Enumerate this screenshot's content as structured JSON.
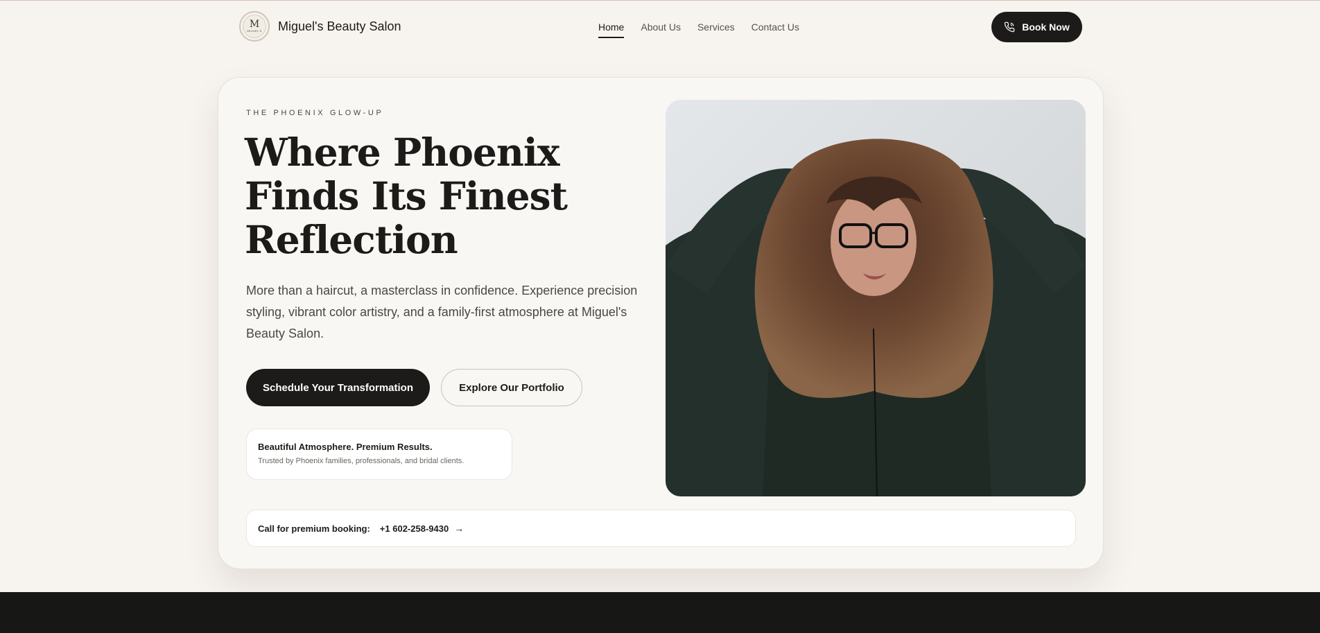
{
  "brand": {
    "name": "Miguel's Beauty Salon",
    "logo_mark": "M",
    "logo_text": "MIGUEL'S"
  },
  "nav": {
    "items": [
      {
        "label": "Home",
        "active": true
      },
      {
        "label": "About Us",
        "active": false
      },
      {
        "label": "Services",
        "active": false
      },
      {
        "label": "Contact Us",
        "active": false
      }
    ],
    "book_label": "Book Now",
    "book_icon": "phone-icon"
  },
  "hero": {
    "eyebrow": "THE PHOENIX GLOW-UP",
    "headline_lines": [
      "Where Phoenix",
      "Finds Its Finest",
      "Reflection"
    ],
    "lede": "More than a haircut, a masterclass in confidence. Experience precision styling, vibrant color artistry, and a family-first atmosphere at Miguel's Beauty Salon.",
    "primary_cta": "Schedule Your Transformation",
    "secondary_cta": "Explore Our Portfolio",
    "trust": {
      "title": "Beautiful Atmosphere. Premium Results.",
      "subtitle": "Trusted by Phoenix families, professionals, and bridal clients."
    },
    "call": {
      "label": "Call for premium booking:",
      "phone": "+1 602-258-9430",
      "arrow": "→"
    }
  },
  "colors": {
    "background": "#f7f3ef",
    "ink": "#1c1b19",
    "card": "#f9f7f3",
    "footer": "#171716"
  }
}
